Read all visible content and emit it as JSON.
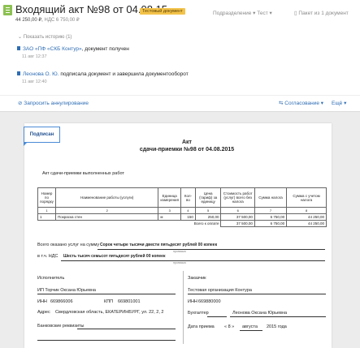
{
  "header": {
    "title": "Входящий акт №98 от 04.08.15",
    "badge": "Тестовый документ",
    "classify": "Подразделение ▾ Тест ▾",
    "package": "Пакет из 1 документ",
    "sum": "44 250,00 ₽,",
    "vat": "НДС 6 750,00 ₽"
  },
  "history": {
    "label": "Показать историю (1)"
  },
  "events": [
    {
      "actor": "ЗАО «ПФ «СКБ Контур»",
      "text": ", документ получен",
      "time": "11 авг 12:37"
    },
    {
      "actor": "Леонова О. Ю.",
      "text": " подписала документ и завершила документооборот",
      "time": "11 авг 12:40"
    }
  ],
  "actions": {
    "cancel": "Запросить аннулирование",
    "approval": "Согласование ▾",
    "more": "Ещё ▾"
  },
  "doc": {
    "stamp": "Подписан",
    "title1": "Акт",
    "title2": "сдачи-приемки №98 от 04.08.2015",
    "subtitle": "Акт сдачи-приемки выполненных работ",
    "columns": [
      "Номер по порядку",
      "Наименование работы (услуги)",
      "Единица измерения",
      "Кол-во",
      "Цена (тариф) за единицу",
      "Стоимость работ (услуг) всего без налога",
      "Сумма налога",
      "Сумма с учетом налога"
    ],
    "col_numbers": [
      "1",
      "2",
      "3",
      "4",
      "5",
      "6",
      "7",
      "8"
    ],
    "rows": [
      [
        "1",
        "Покраска стен",
        "м",
        "150",
        "250,00",
        "37 500,00",
        "6 750,00",
        "44 250,00"
      ]
    ],
    "total_label": "Всего к оплате",
    "total": [
      "37 500,00",
      "6 750,00",
      "44 250,00"
    ],
    "rendered_label": "Всего оказано услуг на сумму",
    "rendered_value": "Сорок четыре тысячи двести пятьдесят рублей 00 копеек",
    "rendered_hint": "прописью",
    "vat_label": "в т.ч. НДС",
    "vat_value": "Шесть тысяч семьсот пятьдесят рублей 00 копеек",
    "vat_hint": "прописью",
    "executor": {
      "heading": "Исполнитель",
      "name": "ИП Торчик Оксана Юрьевна",
      "inn_label": "ИНН",
      "inn": "669866006",
      "kpp_label": "КПП",
      "kpp": "669801001",
      "addr_label": "Адрес",
      "addr": "Свердловская область, ЕКАТЕРИНБУРГ, ул. 22, 2, 2",
      "bank_label": "Банковские реквизиты"
    },
    "customer": {
      "heading": "Заказчик",
      "name": "Тестовая организация Контура",
      "inn_label": "ИНН",
      "inn": "669880000",
      "acc_label": "Бухгалтер",
      "acc": "Леонова Оксана Юрьевна",
      "date_label": "Дата приема",
      "date_day": "8",
      "date_month": "августа",
      "date_year": "2015 года"
    }
  }
}
